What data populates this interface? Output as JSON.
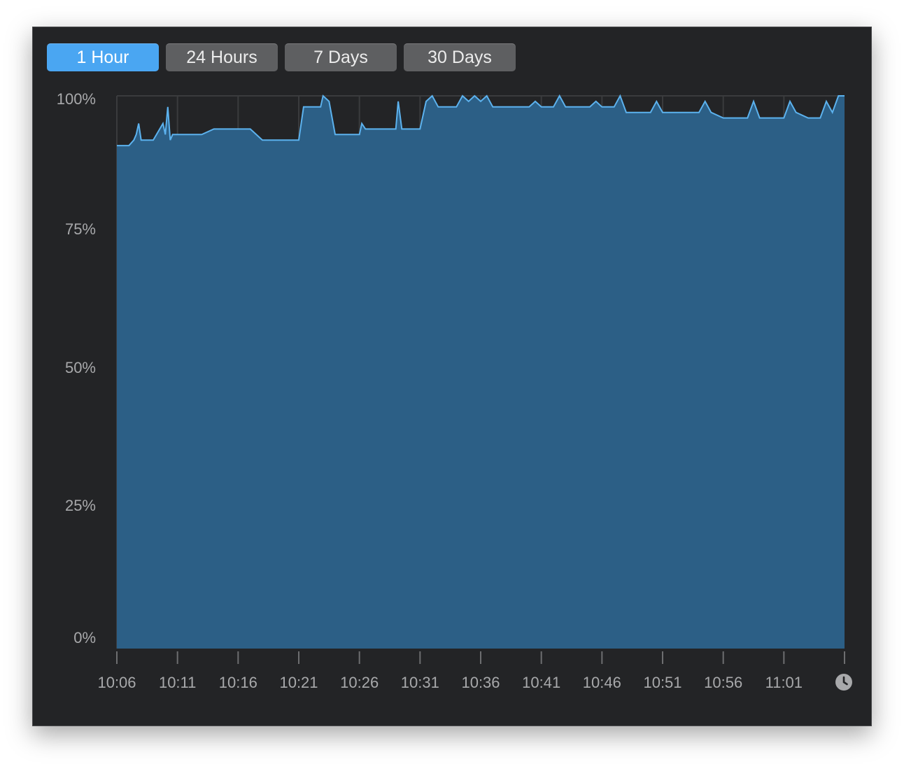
{
  "tabs": [
    {
      "label": "1 Hour",
      "active": true
    },
    {
      "label": "24 Hours",
      "active": false
    },
    {
      "label": "7 Days",
      "active": false
    },
    {
      "label": "30 Days",
      "active": false
    }
  ],
  "colors": {
    "background": "#232426",
    "area_fill": "#2c5f86",
    "line": "#5cb2ee",
    "tab_active": "#4aa6f2",
    "tab_inactive": "#5e5f61",
    "grid": "#3a3b3d",
    "tick_text": "#a8a9ab"
  },
  "icons": {
    "time": "clock-icon"
  },
  "chart_data": {
    "type": "area",
    "title": "",
    "xlabel": "",
    "ylabel": "",
    "ylim": [
      0,
      100
    ],
    "yticks": [
      0,
      25,
      50,
      75,
      100
    ],
    "ytick_labels": [
      "0%",
      "25%",
      "50%",
      "75%",
      "100%"
    ],
    "xlim": [
      "10:06",
      "11:06"
    ],
    "xtick_labels": [
      "10:06",
      "10:11",
      "10:16",
      "10:21",
      "10:26",
      "10:31",
      "10:36",
      "10:41",
      "10:46",
      "10:51",
      "10:56",
      "11:01"
    ],
    "grid": "vertical",
    "series": [
      {
        "x": [
          "10:06",
          "10:07",
          "10:07:24",
          "10:07:36",
          "10:07:48",
          "10:08",
          "10:09",
          "10:09:48",
          "10:10",
          "10:10:12",
          "10:10:24",
          "10:10:36",
          "10:10:48",
          "10:11",
          "10:12",
          "10:13",
          "10:14",
          "10:15",
          "10:16",
          "10:17",
          "10:18",
          "10:19",
          "10:20",
          "10:21",
          "10:21:24",
          "10:22",
          "10:22:48",
          "10:23",
          "10:23:30",
          "10:24",
          "10:25",
          "10:26",
          "10:26:12",
          "10:26:30",
          "10:27",
          "10:28",
          "10:29",
          "10:29:12",
          "10:29:30",
          "10:30",
          "10:31",
          "10:31:30",
          "10:32",
          "10:32:30",
          "10:33",
          "10:34",
          "10:34:30",
          "10:35",
          "10:35:30",
          "10:36",
          "10:36:30",
          "10:37",
          "10:38",
          "10:39",
          "10:40",
          "10:40:30",
          "10:41",
          "10:42",
          "10:42:30",
          "10:43",
          "10:44",
          "10:45",
          "10:45:30",
          "10:46",
          "10:47",
          "10:47:30",
          "10:48",
          "10:49",
          "10:50",
          "10:50:30",
          "10:51",
          "10:52",
          "10:53",
          "10:54",
          "10:54:30",
          "10:55",
          "10:56",
          "10:57",
          "10:58",
          "10:58:30",
          "10:59",
          "11:00",
          "11:01",
          "11:01:30",
          "11:02",
          "11:03",
          "11:04",
          "11:04:30",
          "11:05",
          "11:05:30",
          "11:06"
        ],
        "y": [
          91,
          91,
          92,
          93,
          95,
          92,
          92,
          95,
          93,
          98,
          92,
          93,
          93,
          93,
          93,
          93,
          94,
          94,
          94,
          94,
          92,
          92,
          92,
          92,
          98,
          98,
          98,
          100,
          99,
          93,
          93,
          93,
          95,
          94,
          94,
          94,
          94,
          99,
          94,
          94,
          94,
          99,
          100,
          98,
          98,
          98,
          100,
          99,
          100,
          99,
          100,
          98,
          98,
          98,
          98,
          99,
          98,
          98,
          100,
          98,
          98,
          98,
          99,
          98,
          98,
          100,
          97,
          97,
          97,
          99,
          97,
          97,
          97,
          97,
          99,
          97,
          96,
          96,
          96,
          99,
          96,
          96,
          96,
          99,
          97,
          96,
          96,
          99,
          97,
          100,
          100
        ]
      }
    ]
  }
}
